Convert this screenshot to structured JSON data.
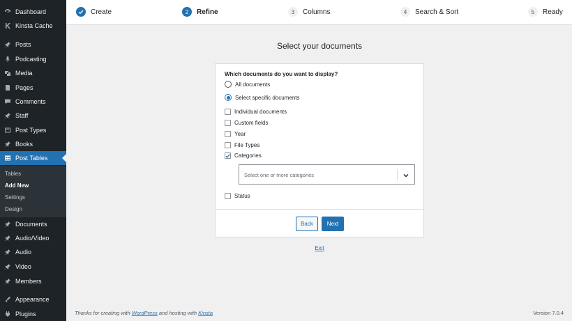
{
  "sidebar": {
    "items": [
      {
        "label": "Dashboard",
        "icon": "dashboard-icon"
      },
      {
        "label": "Kinsta Cache",
        "icon": "kinsta-icon"
      },
      {
        "label": "Posts",
        "icon": "pin-icon"
      },
      {
        "label": "Podcasting",
        "icon": "microphone-icon"
      },
      {
        "label": "Media",
        "icon": "media-icon"
      },
      {
        "label": "Pages",
        "icon": "pages-icon"
      },
      {
        "label": "Comments",
        "icon": "comment-icon"
      },
      {
        "label": "Staff",
        "icon": "pin-icon"
      },
      {
        "label": "Post Types",
        "icon": "post-types-icon"
      },
      {
        "label": "Books",
        "icon": "pin-icon"
      },
      {
        "label": "Post Tables",
        "icon": "table-icon"
      },
      {
        "label": "Documents",
        "icon": "pin-icon"
      },
      {
        "label": "Audio/Video",
        "icon": "pin-icon"
      },
      {
        "label": "Audio",
        "icon": "pin-icon"
      },
      {
        "label": "Video",
        "icon": "pin-icon"
      },
      {
        "label": "Members",
        "icon": "pin-icon"
      },
      {
        "label": "Appearance",
        "icon": "appearance-icon"
      },
      {
        "label": "Plugins",
        "icon": "plugins-icon"
      }
    ],
    "submenu": [
      "Tables",
      "Add New",
      "Settings",
      "Design"
    ]
  },
  "steps": [
    {
      "num": "1",
      "label": "Create",
      "state": "done"
    },
    {
      "num": "2",
      "label": "Refine",
      "state": "current"
    },
    {
      "num": "3",
      "label": "Columns",
      "state": "todo"
    },
    {
      "num": "4",
      "label": "Search & Sort",
      "state": "todo"
    },
    {
      "num": "5",
      "label": "Ready",
      "state": "todo"
    }
  ],
  "main": {
    "title": "Select your documents",
    "question": "Which documents do you want to display?",
    "radios": {
      "all": "All documents",
      "specific": "Select specific documents"
    },
    "checkboxes": {
      "individual": "Individual documents",
      "custom_fields": "Custom fields",
      "year": "Year",
      "file_types": "File Types",
      "categories": "Categories",
      "status": "Status"
    },
    "select_placeholder": "Select one or more categories",
    "back": "Back",
    "next": "Next",
    "exit": "Exit"
  },
  "footer": {
    "thanks": "Thanks for creating with ",
    "wordpress": "WordPress",
    "hosting": " and hosting with ",
    "kinsta": "Kinsta",
    "version": "Version 7.0.4"
  },
  "colors": {
    "accent": "#2271b1",
    "sidebar": "#1d2327",
    "background": "#f0f0f1"
  }
}
